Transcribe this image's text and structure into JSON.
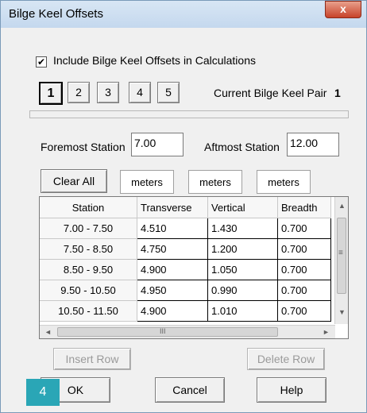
{
  "window": {
    "title": "Bilge Keel Offsets",
    "close_label": "x"
  },
  "include_checkbox": {
    "label": "Include Bilge Keel Offsets in Calculations",
    "checked": true,
    "mark": "✔"
  },
  "pair_buttons": [
    "1",
    "2",
    "3",
    "4",
    "5"
  ],
  "current_pair": {
    "label": "Current Bilge Keel Pair",
    "value": "1"
  },
  "foremost": {
    "label": "Foremost Station",
    "value": "7.00"
  },
  "aftmost": {
    "label": "Aftmost Station",
    "value": "12.00"
  },
  "clear_all_label": "Clear All",
  "units": [
    "meters",
    "meters",
    "meters"
  ],
  "table": {
    "headers": [
      "Station",
      "Transverse",
      "Vertical",
      "Breadth"
    ],
    "rows": [
      [
        "7.00 - 7.50",
        "4.510",
        "1.430",
        "0.700"
      ],
      [
        "7.50 - 8.50",
        "4.750",
        "1.200",
        "0.700"
      ],
      [
        "8.50 - 9.50",
        "4.900",
        "1.050",
        "0.700"
      ],
      [
        "9.50 - 10.50",
        "4.950",
        "0.990",
        "0.700"
      ],
      [
        "10.50 - 11.50",
        "4.900",
        "1.010",
        "0.700"
      ]
    ]
  },
  "scroll": {
    "up": "▲",
    "down": "▼",
    "left": "◄",
    "right": "►",
    "vgrip": "≡",
    "hgrip": "III"
  },
  "insert_row_label": "Insert Row",
  "delete_row_label": "Delete Row",
  "ok_label": "OK",
  "cancel_label": "Cancel",
  "help_label": "Help",
  "badge": "4",
  "colors": {
    "badge": "#2aa6b6",
    "close": "#c7432a",
    "titlebar": "#c4d8ee"
  }
}
